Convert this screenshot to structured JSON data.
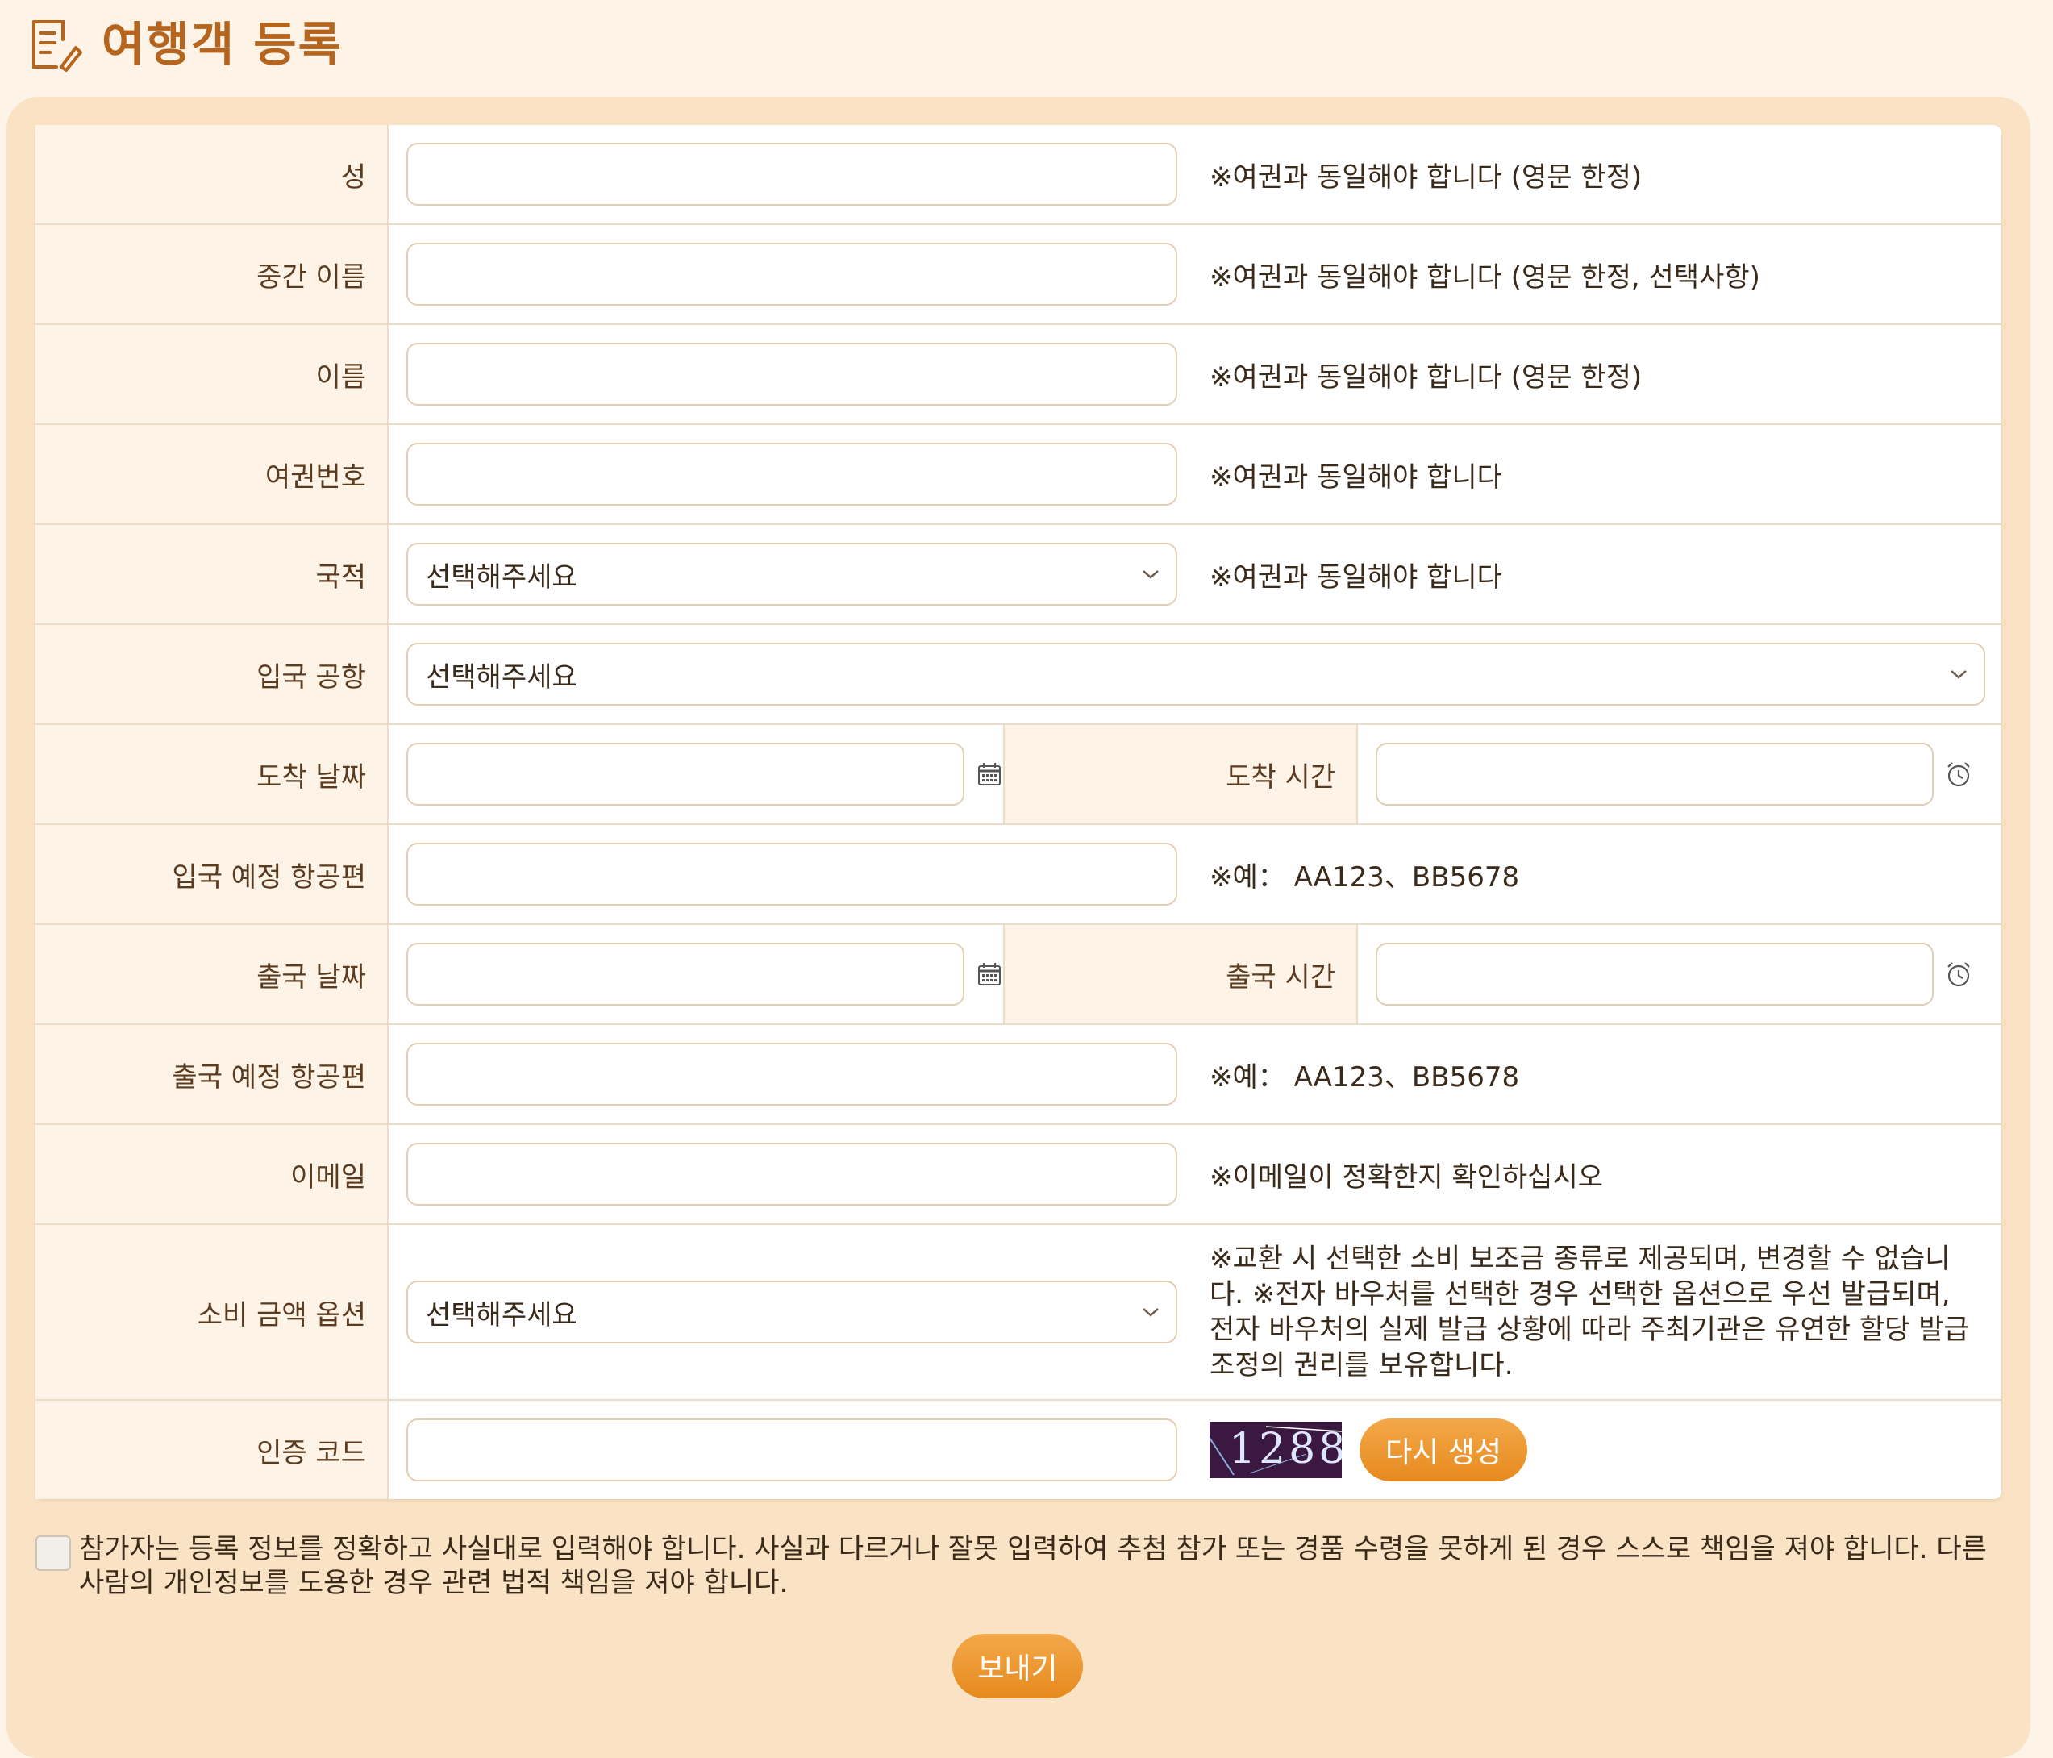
{
  "header": {
    "title": "여행객 등록",
    "icon": "document-edit-icon"
  },
  "fields": {
    "last_name": {
      "label": "성",
      "note": "※여권과 동일해야 합니다 (영문 한정)"
    },
    "middle_name": {
      "label": "중간 이름",
      "note": "※여권과 동일해야 합니다 (영문 한정, 선택사항)"
    },
    "first_name": {
      "label": "이름",
      "note": "※여권과 동일해야 합니다 (영문 한정)"
    },
    "passport": {
      "label": "여권번호",
      "note": "※여권과 동일해야 합니다"
    },
    "nationality": {
      "label": "국적",
      "selected": "선택해주세요",
      "note": "※여권과 동일해야 합니다"
    },
    "arrival_airport": {
      "label": "입국 공항",
      "selected": "선택해주세요"
    },
    "arrival_date": {
      "label": "도착 날짜",
      "icon": "calendar-icon"
    },
    "arrival_time": {
      "label": "도착 시간",
      "icon": "clock-icon"
    },
    "arrival_flight": {
      "label": "입국 예정 항공편",
      "note": "※예： AA123、BB5678"
    },
    "departure_date": {
      "label": "출국 날짜",
      "icon": "calendar-icon"
    },
    "departure_time": {
      "label": "출국 시간",
      "icon": "clock-icon"
    },
    "departure_flight": {
      "label": "출국 예정 항공편",
      "note": "※예： AA123、BB5678"
    },
    "email": {
      "label": "이메일",
      "note": "※이메일이 정확한지 확인하십시오"
    },
    "spending": {
      "label": "소비 금액 옵션",
      "selected": "선택해주세요",
      "note": "※교환 시 선택한 소비 보조금 종류로 제공되며, 변경할 수 없습니다. ※전자 바우처를 선택한 경우 선택한 옵션으로 우선 발급되며, 전자 바우처의 실제 발급 상황에 따라 주최기관은 유연한 할당 발급 조정의 권리를 보유합니다."
    },
    "captcha": {
      "label": "인증 코드",
      "code": "1288",
      "regen_label": "다시 생성"
    }
  },
  "agreement": {
    "text": "참가자는 등록 정보를 정확하고 사실대로 입력해야 합니다. 사실과 다르거나 잘못 입력하여 추첨 참가 또는 경품 수령을 못하게 된 경우 스스로 책임을 져야 합니다. 다른 사람의 개인정보를 도용한 경우 관련 법적 책임을 져야 합니다."
  },
  "submit_label": "보내기"
}
